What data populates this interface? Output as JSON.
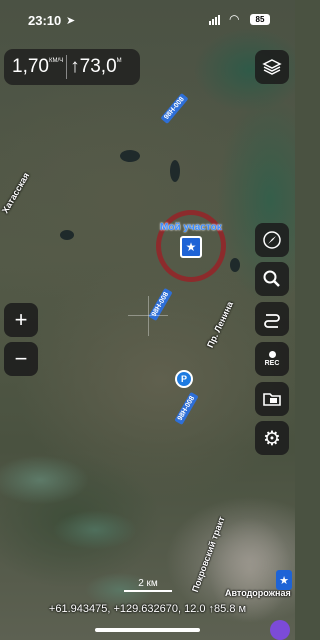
{
  "status_bar": {
    "time": "23:10",
    "battery": "85"
  },
  "speed_panel": {
    "speed": "1,70",
    "speed_unit": "КМ/Ч",
    "separator": "|",
    "altitude": "↑73,0",
    "altitude_unit": "М"
  },
  "map": {
    "favorite_label": "Мой участок",
    "road_labels": [
      "98Н-008",
      "98Н-008",
      "98Н-008"
    ],
    "streets": [
      "Хатасская",
      "Пр. Ленина",
      "Покровский тракт",
      "Автодорожная"
    ],
    "pin_label": "Р"
  },
  "controls": {
    "zoom_in": "+",
    "zoom_out": "−",
    "rec_label": "REC"
  },
  "footer": {
    "scale": "2 км",
    "coordinates": "+61.943475, +129.632670, 12.0  ↑85.8 м"
  },
  "colors": {
    "accent": "#1e63d6",
    "circle": "#962328",
    "panel": "#1c1c1c"
  }
}
